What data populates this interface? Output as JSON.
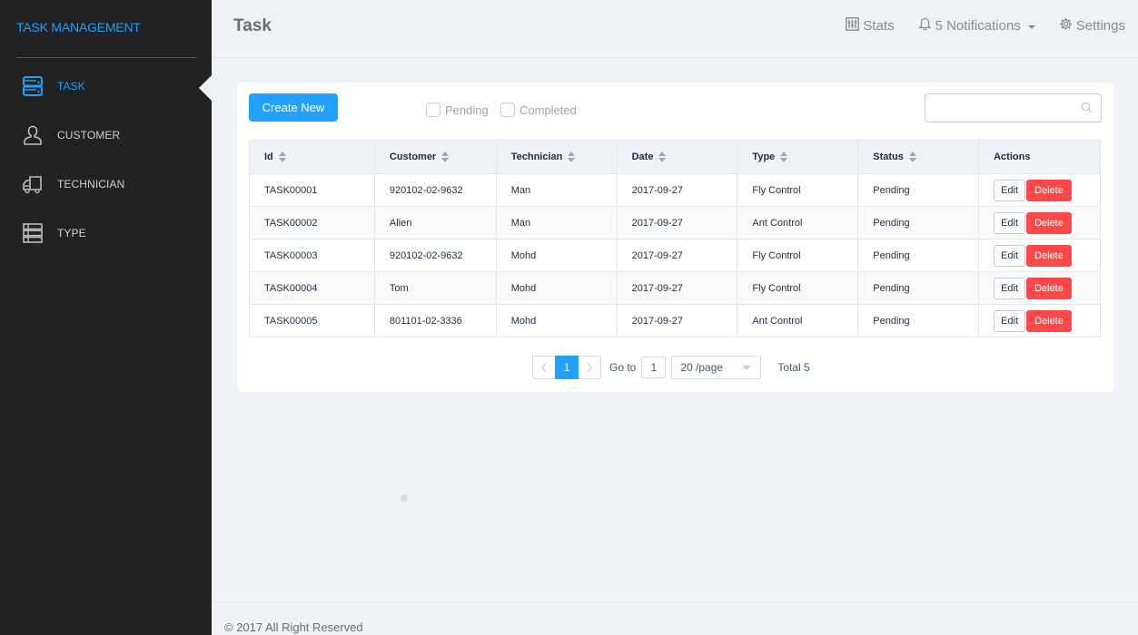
{
  "sidebar": {
    "brand": "TASK MANAGEMENT",
    "items": [
      {
        "label": "TASK",
        "icon": "server-icon",
        "active": true
      },
      {
        "label": "CUSTOMER",
        "icon": "user-icon",
        "active": false
      },
      {
        "label": "TECHNICIAN",
        "icon": "truck-icon",
        "active": false
      },
      {
        "label": "TYPE",
        "icon": "list-icon",
        "active": false
      }
    ]
  },
  "header": {
    "title": "Task",
    "stats_label": "Stats",
    "notifications_label": "5 Notifications",
    "settings_label": "Settings"
  },
  "toolbar": {
    "create_label": "Create New",
    "filters": [
      {
        "label": "Pending",
        "checked": false
      },
      {
        "label": "Completed",
        "checked": false
      }
    ],
    "search_value": "",
    "search_placeholder": ""
  },
  "table": {
    "columns": [
      "Id",
      "Customer",
      "Technician",
      "Date",
      "Type",
      "Status",
      "Actions"
    ],
    "rows": [
      {
        "id": "TASK00001",
        "customer": "920102-02-9632",
        "technician": "Man",
        "date": "2017-09-27",
        "type": "Fly Control",
        "status": "Pending"
      },
      {
        "id": "TASK00002",
        "customer": "Alien",
        "technician": "Man",
        "date": "2017-09-27",
        "type": "Ant Control",
        "status": "Pending"
      },
      {
        "id": "TASK00003",
        "customer": "920102-02-9632",
        "technician": "Mohd",
        "date": "2017-09-27",
        "type": "Fly Control",
        "status": "Pending"
      },
      {
        "id": "TASK00004",
        "customer": "Tom",
        "technician": "Mohd",
        "date": "2017-09-27",
        "type": "Fly Control",
        "status": "Pending"
      },
      {
        "id": "TASK00005",
        "customer": "801101-02-3336",
        "technician": "Mohd",
        "date": "2017-09-27",
        "type": "Ant Control",
        "status": "Pending"
      }
    ],
    "edit_label": "Edit",
    "delete_label": "Delete"
  },
  "pagination": {
    "current_page": "1",
    "goto_label": "Go to",
    "goto_value": "1",
    "page_size": "20 /page",
    "total": "Total 5"
  },
  "footer": {
    "text": "© 2017 All Right Reserved"
  },
  "colors": {
    "accent": "#20a0ff",
    "danger": "#ff4949",
    "sidebar_bg": "#222222",
    "page_bg": "#eef1f6"
  }
}
